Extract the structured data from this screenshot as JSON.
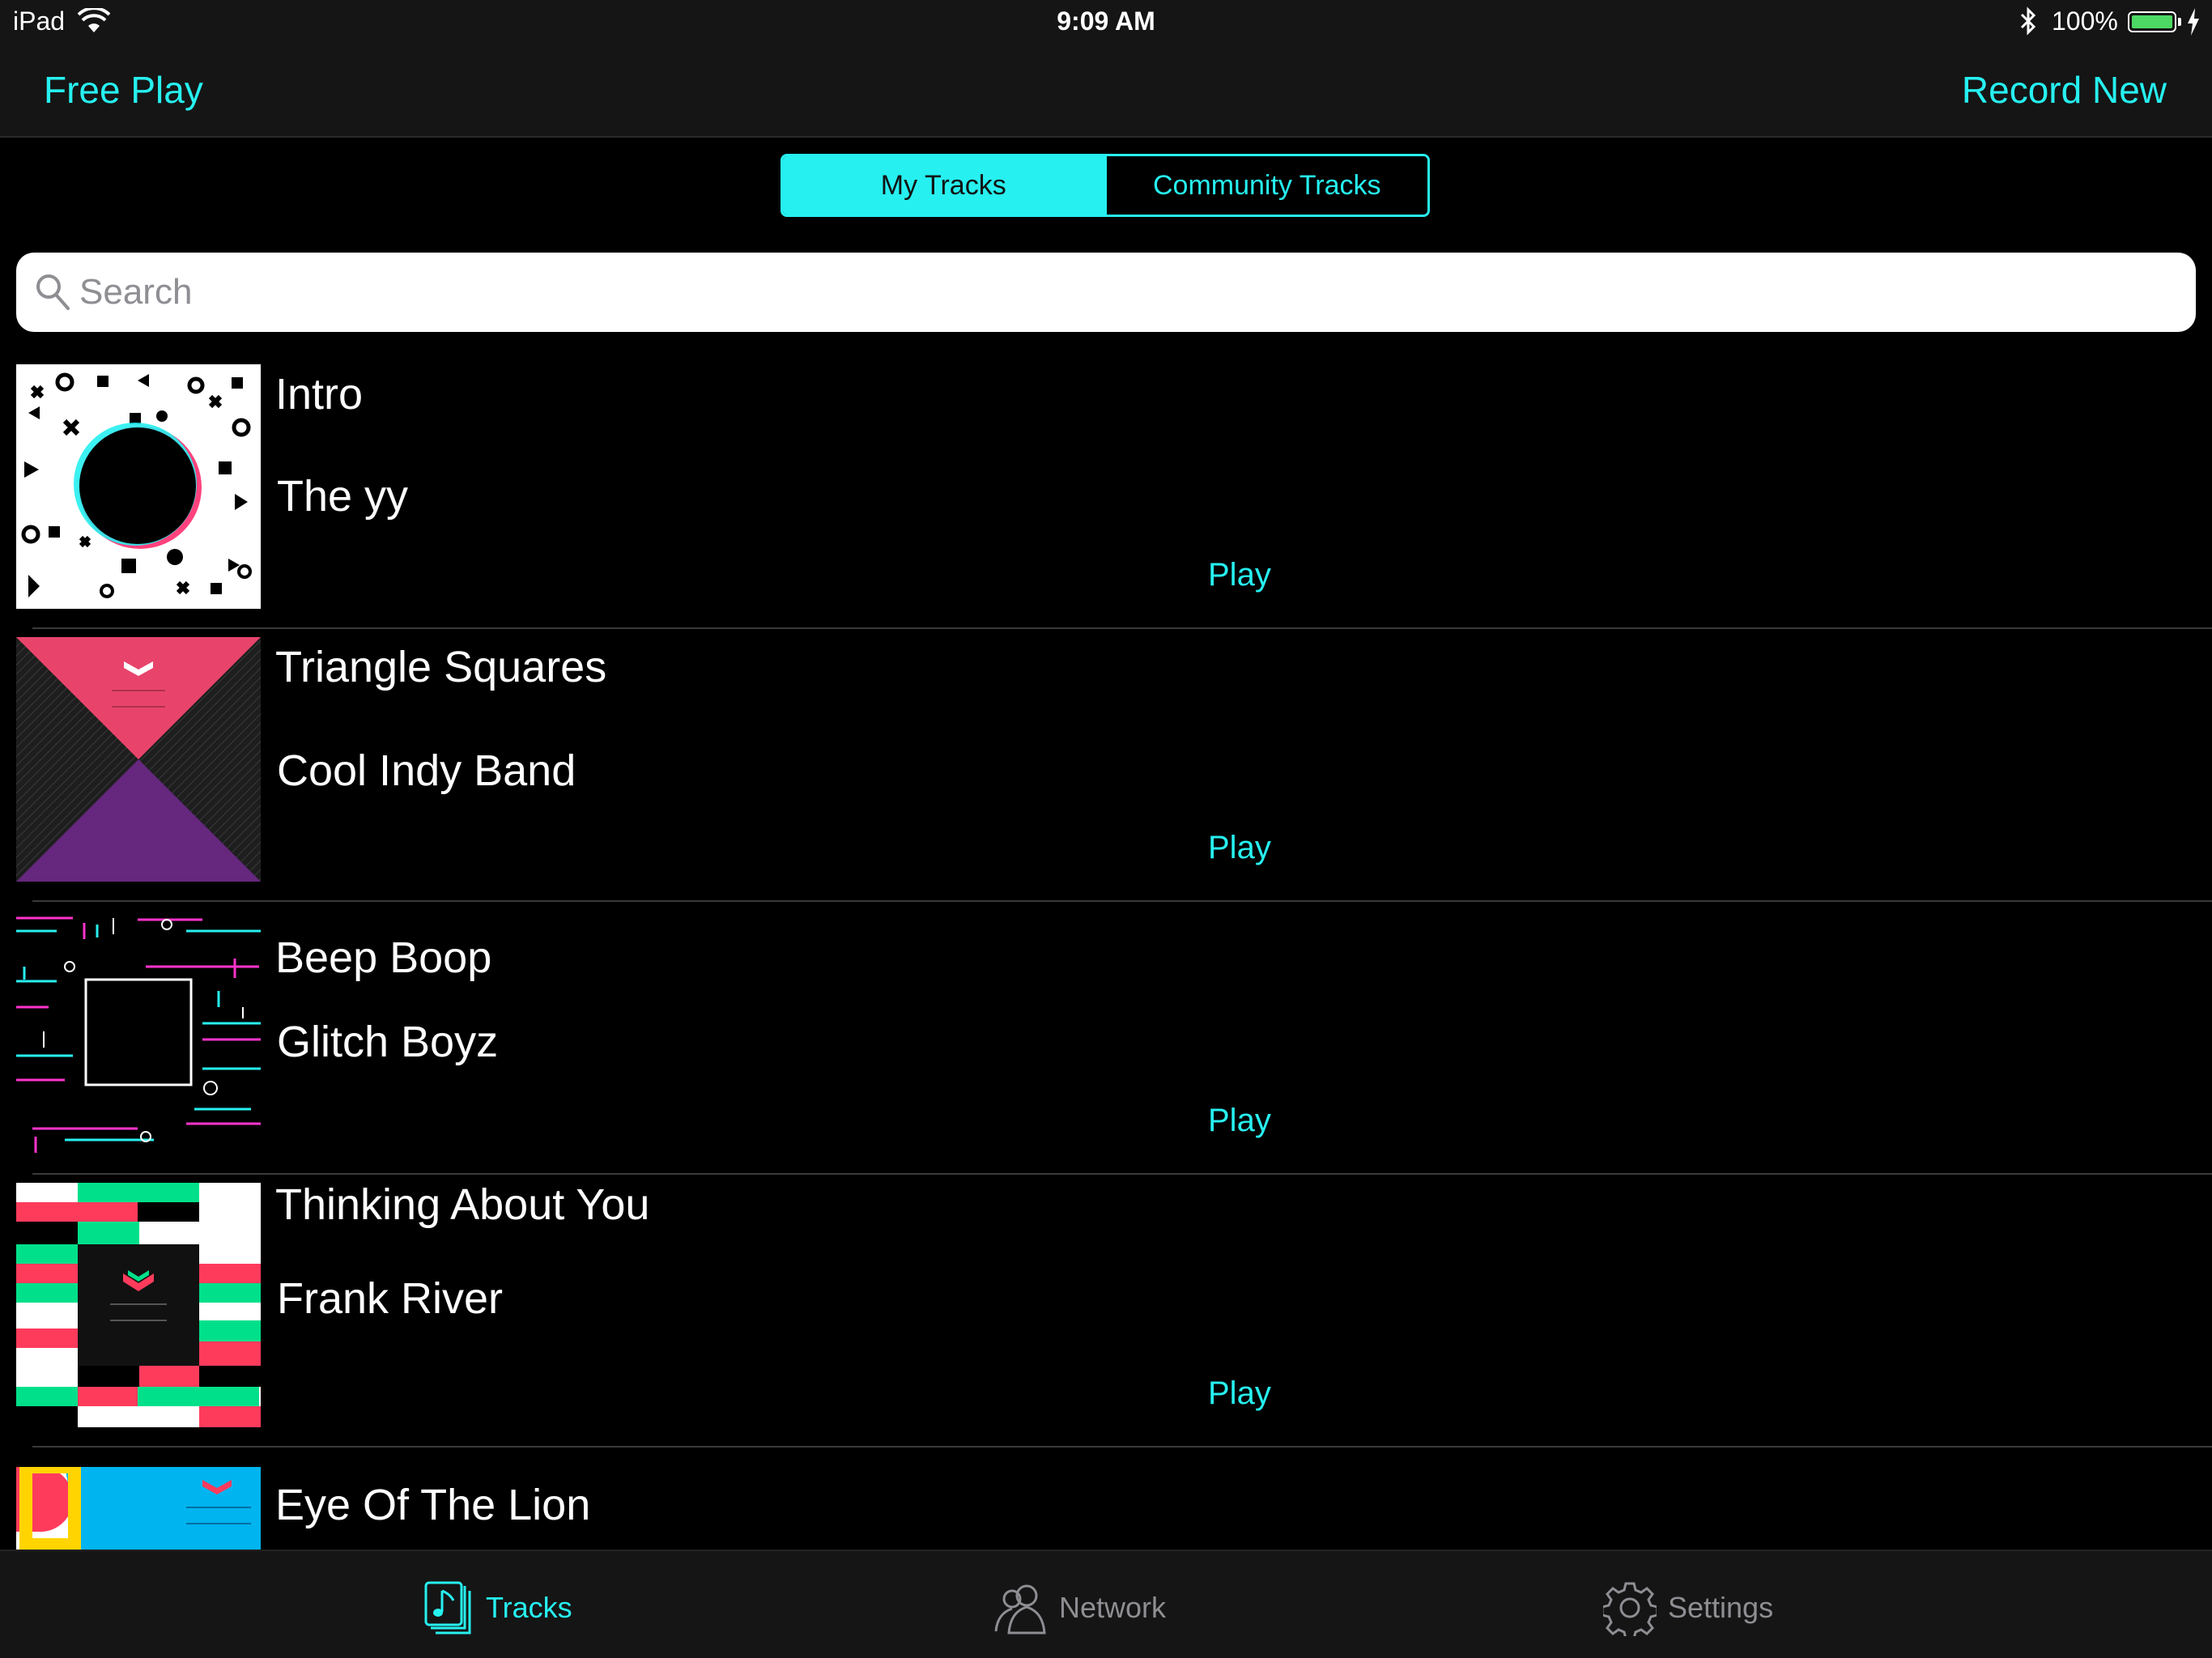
{
  "status_bar": {
    "device": "iPad",
    "time": "9:09 AM",
    "battery": "100%"
  },
  "nav": {
    "left_button": "Free Play",
    "right_button": "Record New"
  },
  "segments": {
    "active": "My Tracks",
    "inactive": "Community Tracks"
  },
  "search": {
    "placeholder": "Search",
    "value": ""
  },
  "tracks": [
    {
      "title": "Intro",
      "artist": "The yy",
      "action": "Play",
      "art": "circle-shapes-art"
    },
    {
      "title": "Triangle Squares",
      "artist": "Cool Indy Band",
      "action": "Play",
      "art": "triangles-art"
    },
    {
      "title": "Beep Boop",
      "artist": "Glitch Boyz",
      "action": "Play",
      "art": "glitch-art"
    },
    {
      "title": "Thinking About You",
      "artist": "Frank River",
      "action": "Play",
      "art": "blocks-art"
    },
    {
      "title": "Eye Of The Lion",
      "art": "blue-art"
    }
  ],
  "tabs": [
    {
      "label": "Tracks",
      "icon": "music-note-icon",
      "active": true
    },
    {
      "label": "Network",
      "icon": "people-icon",
      "active": false
    },
    {
      "label": "Settings",
      "icon": "gear-icon",
      "active": false
    }
  ],
  "colors": {
    "accent": "#27f0f0",
    "bar_background": "#151515",
    "background": "#000000"
  }
}
